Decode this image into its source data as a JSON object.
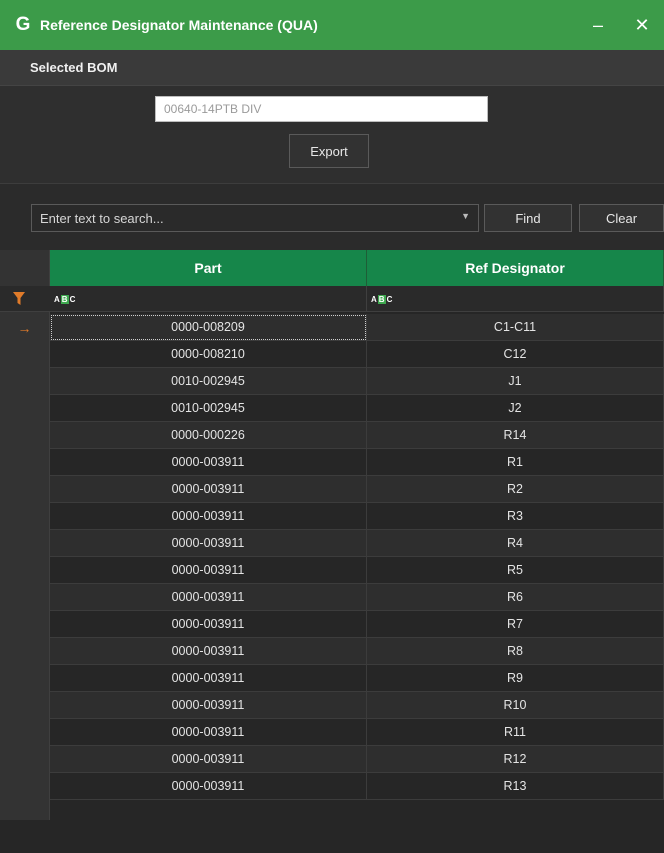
{
  "window": {
    "app_icon": "G",
    "title": "Reference Designator Maintenance (QUA)",
    "minimize_glyph": "–",
    "close_glyph": "✕"
  },
  "bom": {
    "section_title": "Selected BOM",
    "value": "00640-14PTB DIV",
    "export_label": "Export"
  },
  "search": {
    "placeholder": "Enter text to search...",
    "find_label": "Find",
    "clear_label": "Clear"
  },
  "grid": {
    "columns": [
      "Part",
      "Ref Designator"
    ],
    "filter_placeholder": "ABC",
    "rows": [
      {
        "part": "0000-008209",
        "ref": "C1-C11"
      },
      {
        "part": "0000-008210",
        "ref": "C12"
      },
      {
        "part": "0010-002945",
        "ref": "J1"
      },
      {
        "part": "0010-002945",
        "ref": "J2"
      },
      {
        "part": "0000-000226",
        "ref": "R14"
      },
      {
        "part": "0000-003911",
        "ref": "R1"
      },
      {
        "part": "0000-003911",
        "ref": "R2"
      },
      {
        "part": "0000-003911",
        "ref": "R3"
      },
      {
        "part": "0000-003911",
        "ref": "R4"
      },
      {
        "part": "0000-003911",
        "ref": "R5"
      },
      {
        "part": "0000-003911",
        "ref": "R6"
      },
      {
        "part": "0000-003911",
        "ref": "R7"
      },
      {
        "part": "0000-003911",
        "ref": "R8"
      },
      {
        "part": "0000-003911",
        "ref": "R9"
      },
      {
        "part": "0000-003911",
        "ref": "R10"
      },
      {
        "part": "0000-003911",
        "ref": "R11"
      },
      {
        "part": "0000-003911",
        "ref": "R12"
      },
      {
        "part": "0000-003911",
        "ref": "R13"
      }
    ],
    "focused_row_indicator": "→"
  },
  "colors": {
    "titlebar": "#3c9b49",
    "column_header": "#16864a",
    "accent_orange": "#e07b2a"
  }
}
